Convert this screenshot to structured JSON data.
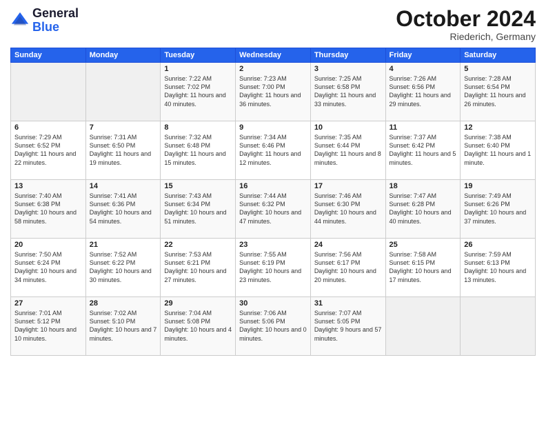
{
  "header": {
    "logo_line1": "General",
    "logo_line2": "Blue",
    "month": "October 2024",
    "location": "Riederich, Germany"
  },
  "weekdays": [
    "Sunday",
    "Monday",
    "Tuesday",
    "Wednesday",
    "Thursday",
    "Friday",
    "Saturday"
  ],
  "weeks": [
    [
      {
        "day": "",
        "content": ""
      },
      {
        "day": "",
        "content": ""
      },
      {
        "day": "1",
        "content": "Sunrise: 7:22 AM\nSunset: 7:02 PM\nDaylight: 11 hours and 40 minutes."
      },
      {
        "day": "2",
        "content": "Sunrise: 7:23 AM\nSunset: 7:00 PM\nDaylight: 11 hours and 36 minutes."
      },
      {
        "day": "3",
        "content": "Sunrise: 7:25 AM\nSunset: 6:58 PM\nDaylight: 11 hours and 33 minutes."
      },
      {
        "day": "4",
        "content": "Sunrise: 7:26 AM\nSunset: 6:56 PM\nDaylight: 11 hours and 29 minutes."
      },
      {
        "day": "5",
        "content": "Sunrise: 7:28 AM\nSunset: 6:54 PM\nDaylight: 11 hours and 26 minutes."
      }
    ],
    [
      {
        "day": "6",
        "content": "Sunrise: 7:29 AM\nSunset: 6:52 PM\nDaylight: 11 hours and 22 minutes."
      },
      {
        "day": "7",
        "content": "Sunrise: 7:31 AM\nSunset: 6:50 PM\nDaylight: 11 hours and 19 minutes."
      },
      {
        "day": "8",
        "content": "Sunrise: 7:32 AM\nSunset: 6:48 PM\nDaylight: 11 hours and 15 minutes."
      },
      {
        "day": "9",
        "content": "Sunrise: 7:34 AM\nSunset: 6:46 PM\nDaylight: 11 hours and 12 minutes."
      },
      {
        "day": "10",
        "content": "Sunrise: 7:35 AM\nSunset: 6:44 PM\nDaylight: 11 hours and 8 minutes."
      },
      {
        "day": "11",
        "content": "Sunrise: 7:37 AM\nSunset: 6:42 PM\nDaylight: 11 hours and 5 minutes."
      },
      {
        "day": "12",
        "content": "Sunrise: 7:38 AM\nSunset: 6:40 PM\nDaylight: 11 hours and 1 minute."
      }
    ],
    [
      {
        "day": "13",
        "content": "Sunrise: 7:40 AM\nSunset: 6:38 PM\nDaylight: 10 hours and 58 minutes."
      },
      {
        "day": "14",
        "content": "Sunrise: 7:41 AM\nSunset: 6:36 PM\nDaylight: 10 hours and 54 minutes."
      },
      {
        "day": "15",
        "content": "Sunrise: 7:43 AM\nSunset: 6:34 PM\nDaylight: 10 hours and 51 minutes."
      },
      {
        "day": "16",
        "content": "Sunrise: 7:44 AM\nSunset: 6:32 PM\nDaylight: 10 hours and 47 minutes."
      },
      {
        "day": "17",
        "content": "Sunrise: 7:46 AM\nSunset: 6:30 PM\nDaylight: 10 hours and 44 minutes."
      },
      {
        "day": "18",
        "content": "Sunrise: 7:47 AM\nSunset: 6:28 PM\nDaylight: 10 hours and 40 minutes."
      },
      {
        "day": "19",
        "content": "Sunrise: 7:49 AM\nSunset: 6:26 PM\nDaylight: 10 hours and 37 minutes."
      }
    ],
    [
      {
        "day": "20",
        "content": "Sunrise: 7:50 AM\nSunset: 6:24 PM\nDaylight: 10 hours and 34 minutes."
      },
      {
        "day": "21",
        "content": "Sunrise: 7:52 AM\nSunset: 6:22 PM\nDaylight: 10 hours and 30 minutes."
      },
      {
        "day": "22",
        "content": "Sunrise: 7:53 AM\nSunset: 6:21 PM\nDaylight: 10 hours and 27 minutes."
      },
      {
        "day": "23",
        "content": "Sunrise: 7:55 AM\nSunset: 6:19 PM\nDaylight: 10 hours and 23 minutes."
      },
      {
        "day": "24",
        "content": "Sunrise: 7:56 AM\nSunset: 6:17 PM\nDaylight: 10 hours and 20 minutes."
      },
      {
        "day": "25",
        "content": "Sunrise: 7:58 AM\nSunset: 6:15 PM\nDaylight: 10 hours and 17 minutes."
      },
      {
        "day": "26",
        "content": "Sunrise: 7:59 AM\nSunset: 6:13 PM\nDaylight: 10 hours and 13 minutes."
      }
    ],
    [
      {
        "day": "27",
        "content": "Sunrise: 7:01 AM\nSunset: 5:12 PM\nDaylight: 10 hours and 10 minutes."
      },
      {
        "day": "28",
        "content": "Sunrise: 7:02 AM\nSunset: 5:10 PM\nDaylight: 10 hours and 7 minutes."
      },
      {
        "day": "29",
        "content": "Sunrise: 7:04 AM\nSunset: 5:08 PM\nDaylight: 10 hours and 4 minutes."
      },
      {
        "day": "30",
        "content": "Sunrise: 7:06 AM\nSunset: 5:06 PM\nDaylight: 10 hours and 0 minutes."
      },
      {
        "day": "31",
        "content": "Sunrise: 7:07 AM\nSunset: 5:05 PM\nDaylight: 9 hours and 57 minutes."
      },
      {
        "day": "",
        "content": ""
      },
      {
        "day": "",
        "content": ""
      }
    ]
  ]
}
